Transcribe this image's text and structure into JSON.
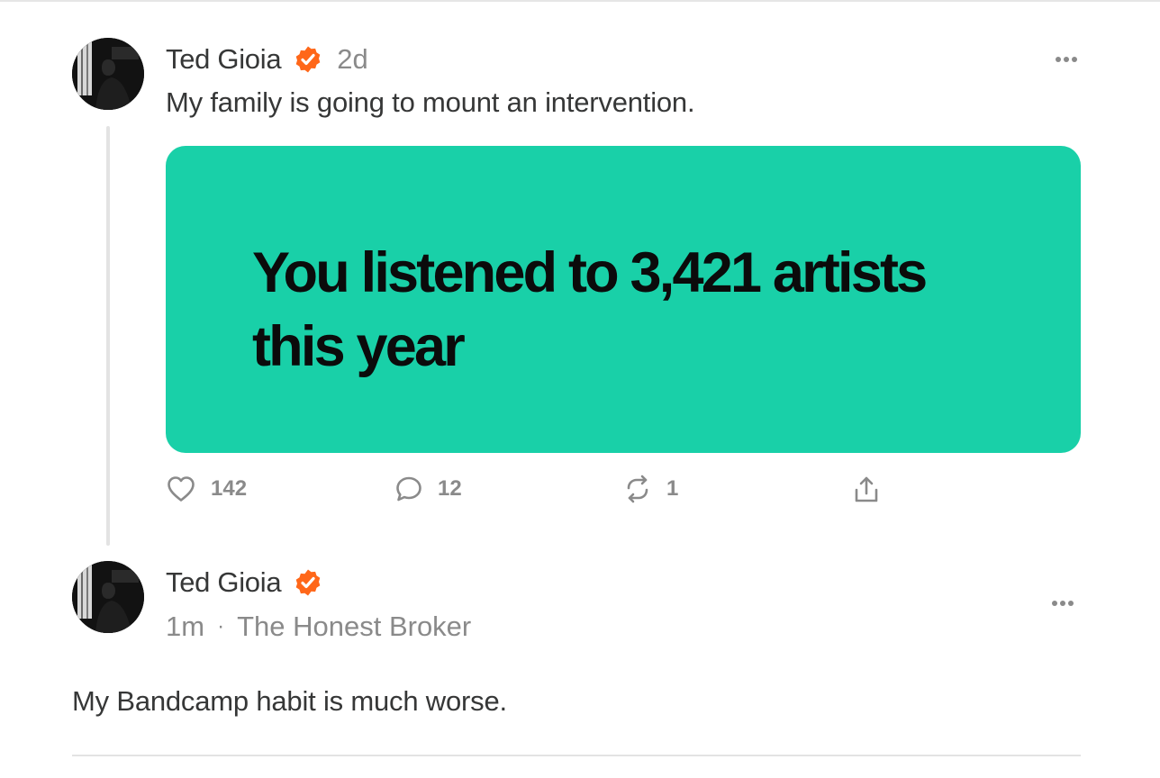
{
  "colors": {
    "accent_orange": "#FF6719",
    "media_background": "#19D0A8",
    "text_primary": "#363737",
    "text_muted": "#8A8A8A"
  },
  "parent_post": {
    "author": "Ted Gioia",
    "verified_icon": "verified-badge-icon",
    "time": "2d",
    "text": "My family is going to mount an intervention.",
    "media": {
      "line1": "You listened to 3,421 artists",
      "line2": "this year"
    },
    "actions": {
      "likes": "142",
      "comments": "12",
      "restacks": "1"
    },
    "icons": [
      "heart-icon",
      "comment-icon",
      "restack-icon",
      "share-icon",
      "more-icon"
    ]
  },
  "reply_post": {
    "author": "Ted Gioia",
    "verified_icon": "verified-badge-icon",
    "time": "1m",
    "separator": "·",
    "publication": "The Honest Broker",
    "text": "My Bandcamp habit is much worse."
  }
}
